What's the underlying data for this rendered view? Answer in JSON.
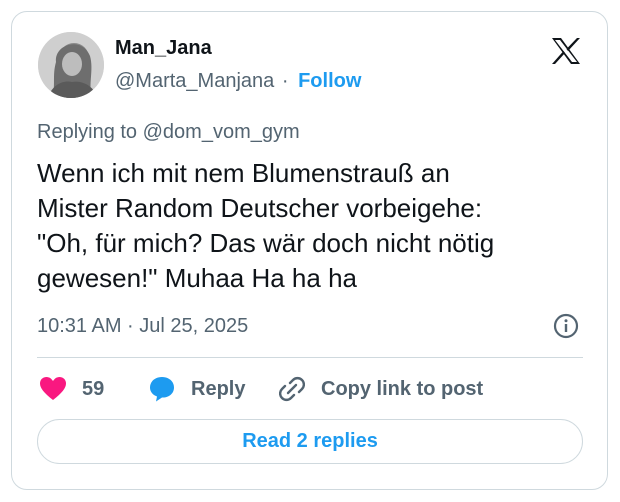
{
  "post": {
    "author_name": "Man_Jana",
    "author_handle": "@Marta_Manjana",
    "separator": "·",
    "follow_label": "Follow",
    "replying_prefix": "Replying to",
    "replying_to": "@dom_vom_gym",
    "text_lines": [
      "Wenn ich mit nem Blumenstrauß an",
      "Mister Random Deutscher vorbeigehe:",
      "\"Oh, für mich? Das wär doch nicht nötig",
      "gewesen!\" Muhaa Ha ha ha"
    ],
    "timestamp": "10:31 AM · Jul 25, 2025",
    "info_icon": "info-icon",
    "logo_icon": "x-logo-icon"
  },
  "actions": {
    "like_count": "59",
    "reply_label": "Reply",
    "copy_label": "Copy link to post",
    "read_replies_label": "Read 2 replies"
  },
  "colors": {
    "like": "#f91880",
    "reply": "#1d9bf0",
    "link": "#1d9bf0",
    "muted": "#536471",
    "text": "#0f1419",
    "border": "#cfd9de"
  }
}
